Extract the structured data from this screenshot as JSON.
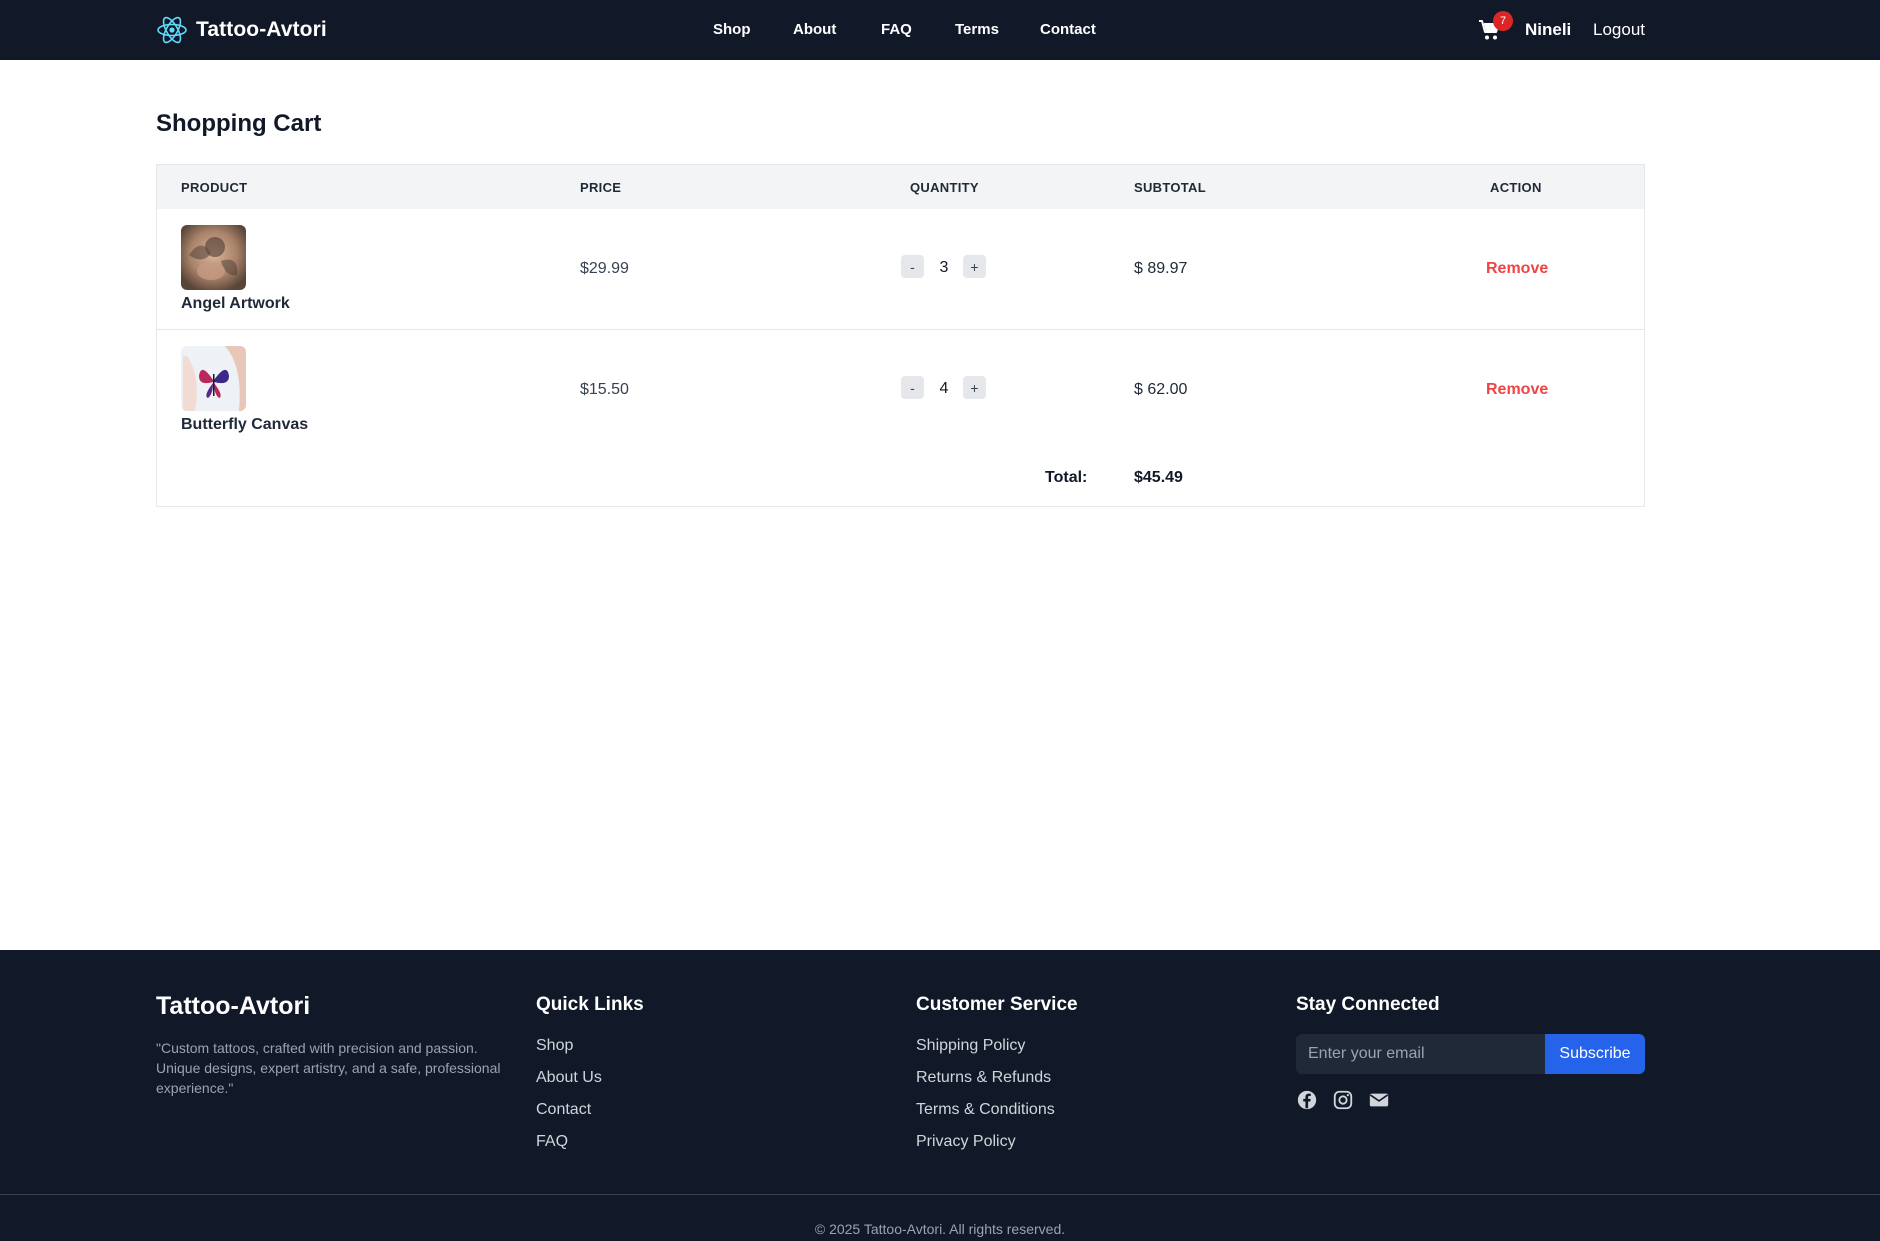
{
  "header": {
    "brand": "Tattoo-Avtori",
    "nav": [
      "Shop",
      "About",
      "FAQ",
      "Terms",
      "Contact"
    ],
    "cart_count": "7",
    "username": "Nineli",
    "logout": "Logout",
    "logo_icon": "react-atom-icon",
    "cart_icon": "shopping-cart-icon"
  },
  "main": {
    "title": "Shopping Cart",
    "columns": [
      "PRODUCT",
      "PRICE",
      "QUANTITY",
      "SUBTOTAL",
      "ACTION"
    ],
    "items": [
      {
        "name": "Angel Artwork",
        "price": "$29.99",
        "quantity": "3",
        "subtotal": "$ 89.97",
        "action": "Remove",
        "thumb": "angel-tattoo-image"
      },
      {
        "name": "Butterfly Canvas",
        "price": "$15.50",
        "quantity": "4",
        "subtotal": "$ 62.00",
        "action": "Remove",
        "thumb": "butterfly-tattoo-image"
      }
    ],
    "decrement": "-",
    "increment": "+",
    "total_label": "Total:",
    "total_value": "$45.49"
  },
  "footer": {
    "brand": "Tattoo-Avtori",
    "description": "\"Custom tattoos, crafted with precision and passion. Unique designs, expert artistry, and a safe, professional experience.\"",
    "quick_links": {
      "title": "Quick Links",
      "links": [
        "Shop",
        "About Us",
        "Contact",
        "FAQ"
      ]
    },
    "customer_service": {
      "title": "Customer Service",
      "links": [
        "Shipping Policy",
        "Returns & Refunds",
        "Terms & Conditions",
        "Privacy Policy"
      ]
    },
    "stay_connected": {
      "title": "Stay Connected",
      "email_placeholder": "Enter your email",
      "subscribe": "Subscribe",
      "icons": [
        "facebook-icon",
        "instagram-icon",
        "envelope-icon"
      ]
    },
    "copyright": "© 2025 Tattoo-Avtori. All rights reserved."
  },
  "colors": {
    "header_bg": "#111827",
    "accent_blue": "#2563eb",
    "remove_red": "#ef4444",
    "badge_red": "#dc2626",
    "logo_cyan": "#61dafb"
  }
}
